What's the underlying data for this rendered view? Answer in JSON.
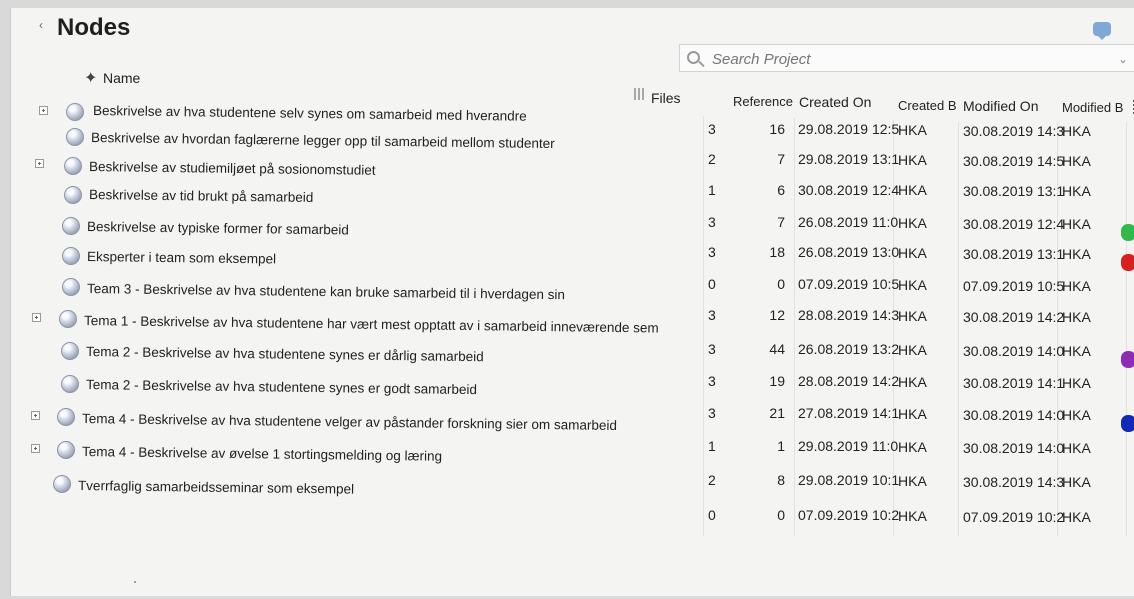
{
  "panel": {
    "title": "Nodes",
    "search_placeholder": "Search Project"
  },
  "headers": {
    "name": "Name",
    "files": "Files",
    "references": "Reference",
    "created_on": "Created On",
    "created_by": "Created B",
    "modified_on": "Modified On",
    "modified_by": "Modified B"
  },
  "rows": [
    {
      "name": "Beskrivelse av hva studentene selv synes om samarbeid med hverandre",
      "files": "3",
      "references": "16",
      "created_on": "29.08.2019 12:5",
      "created_by": "HKA",
      "modified_on": "30.08.2019 14:3",
      "modified_by": "HKA"
    },
    {
      "name": "Beskrivelse av hvordan faglærerne legger opp til samarbeid mellom studenter",
      "files": "2",
      "references": "7",
      "created_on": "29.08.2019 13:1",
      "created_by": "HKA",
      "modified_on": "30.08.2019 14:5",
      "modified_by": "HKA"
    },
    {
      "name": "Beskrivelse av studiemiljøet på sosionomstudiet",
      "files": "1",
      "references": "6",
      "created_on": "30.08.2019 12:4",
      "created_by": "HKA",
      "modified_on": "30.08.2019 13:1",
      "modified_by": "HKA"
    },
    {
      "name": "Beskrivelse av tid brukt på samarbeid",
      "files": "3",
      "references": "7",
      "created_on": "26.08.2019 11:0",
      "created_by": "HKA",
      "modified_on": "30.08.2019 12:4",
      "modified_by": "HKA"
    },
    {
      "name": "Beskrivelse av typiske former for samarbeid",
      "files": "3",
      "references": "18",
      "created_on": "26.08.2019 13:0",
      "created_by": "HKA",
      "modified_on": "30.08.2019 13:1",
      "modified_by": "HKA"
    },
    {
      "name": "Eksperter i team som eksempel",
      "files": "0",
      "references": "0",
      "created_on": "07.09.2019 10:5",
      "created_by": "HKA",
      "modified_on": "07.09.2019 10:5",
      "modified_by": "HKA"
    },
    {
      "name": "Team 3 - Beskrivelse av hva studentene kan bruke samarbeid til i hverdagen sin",
      "files": "3",
      "references": "12",
      "created_on": "28.08.2019 14:3",
      "created_by": "HKA",
      "modified_on": "30.08.2019 14:2",
      "modified_by": "HKA"
    },
    {
      "name": "Tema 1 - Beskrivelse av hva studentene har vært mest opptatt av i samarbeid inneværende sem",
      "files": "3",
      "references": "44",
      "created_on": "26.08.2019 13:2",
      "created_by": "HKA",
      "modified_on": "30.08.2019 14:0",
      "modified_by": "HKA"
    },
    {
      "name": "Tema 2 - Beskrivelse av hva studentene synes er dårlig samarbeid",
      "files": "3",
      "references": "19",
      "created_on": "28.08.2019 14:2",
      "created_by": "HKA",
      "modified_on": "30.08.2019 14:1",
      "modified_by": "HKA"
    },
    {
      "name": "Tema 2 - Beskrivelse av hva studentene synes er godt samarbeid",
      "files": "3",
      "references": "21",
      "created_on": "27.08.2019 14:1",
      "created_by": "HKA",
      "modified_on": "30.08.2019 14:0",
      "modified_by": "HKA"
    },
    {
      "name": "Tema 4 - Beskrivelse av hva studentene velger av påstander forskning sier om samarbeid",
      "files": "1",
      "references": "1",
      "created_on": "29.08.2019 11:0",
      "created_by": "HKA",
      "modified_on": "30.08.2019 14:0",
      "modified_by": "HKA"
    },
    {
      "name": "Tema 4 - Beskrivelse av øvelse 1 stortingsmelding og læring",
      "files": "2",
      "references": "8",
      "created_on": "29.08.2019 10:1",
      "created_by": "HKA",
      "modified_on": "30.08.2019 14:3",
      "modified_by": "HKA"
    },
    {
      "name": "Tverrfaglig samarbeidsseminar som eksempel",
      "files": "0",
      "references": "0",
      "created_on": "07.09.2019 10:2",
      "created_by": "HKA",
      "modified_on": "07.09.2019 10:2",
      "modified_by": "HKA"
    }
  ],
  "colors": {
    "green": "#33b84a",
    "red": "#d91e1e",
    "purple": "#8f2bb5",
    "blue": "#1029b8"
  }
}
